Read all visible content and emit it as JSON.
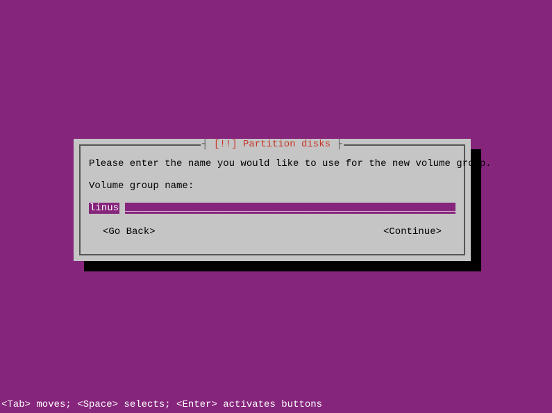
{
  "dialog": {
    "title_prefix": "┤ ",
    "title_marker": "[!!]",
    "title_text": " Partition disks ",
    "title_suffix": "├",
    "prompt": "Please enter the name you would like to use for the new volume group.",
    "field_label": "Volume group name:",
    "input_value": "linus",
    "input_fill": "________________________________________________________________",
    "go_back_label": "<Go Back>",
    "continue_label": "<Continue>"
  },
  "footer": {
    "hint": "<Tab> moves; <Space> selects; <Enter> activates buttons"
  }
}
